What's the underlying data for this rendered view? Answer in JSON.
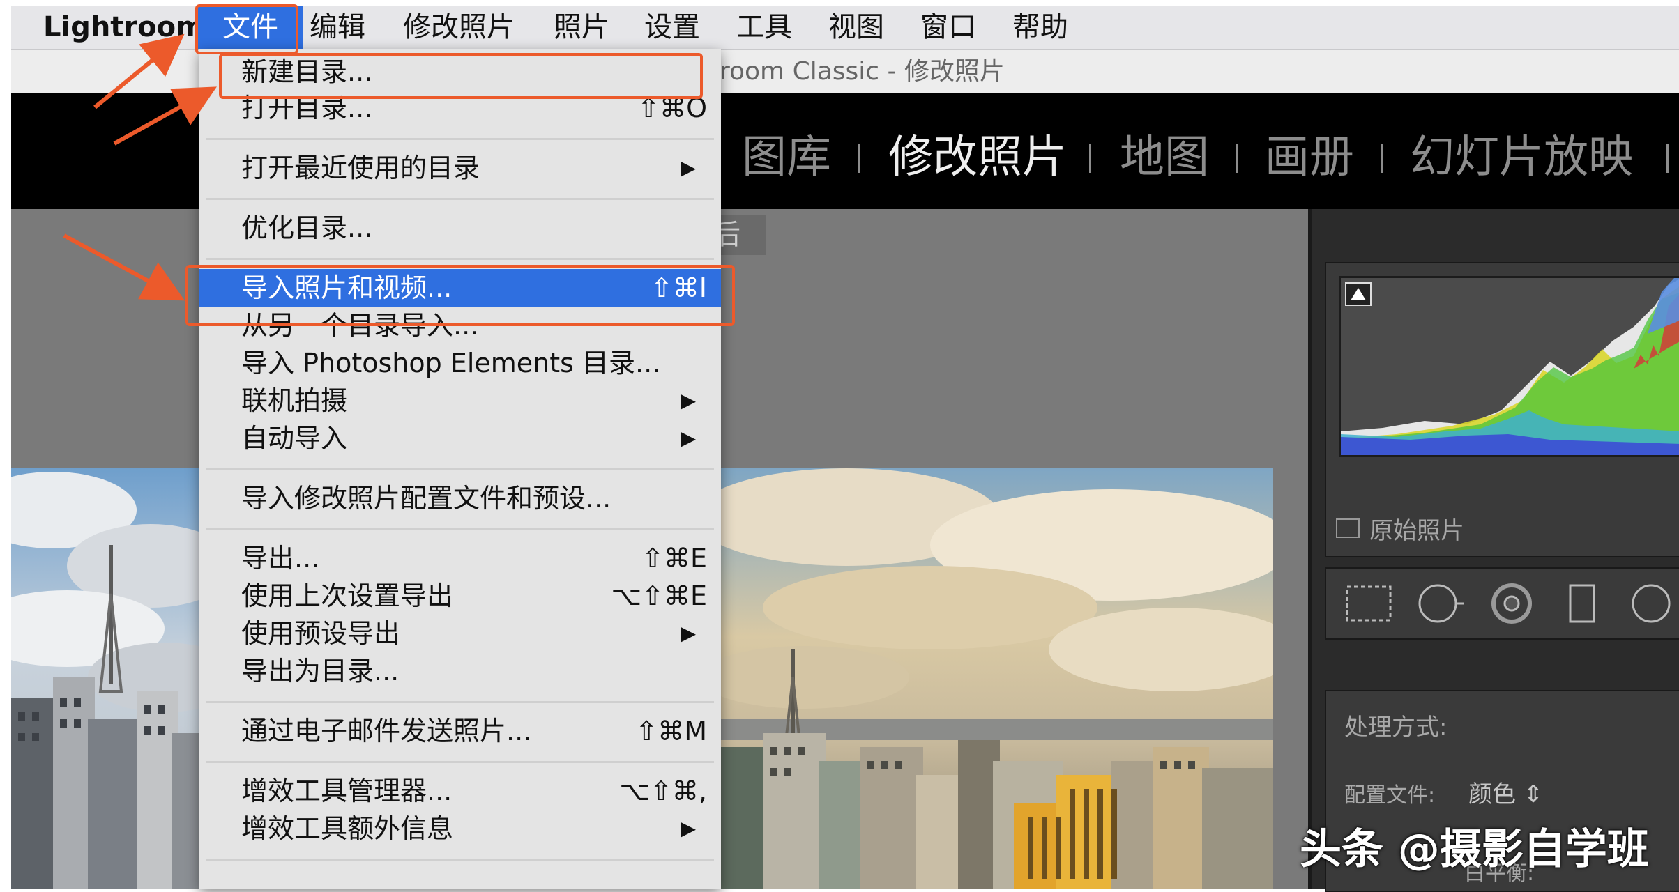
{
  "menubar": {
    "app": "Lightroom",
    "items": [
      "文件",
      "编辑",
      "修改照片",
      "照片",
      "设置",
      "工具",
      "视图",
      "窗口",
      "帮助"
    ]
  },
  "window_title": "room Classic - 修改照片",
  "modules": [
    "图库",
    "修改照片",
    "地图",
    "画册",
    "幻灯片放映"
  ],
  "active_module": "修改照片",
  "before_after_label": "后",
  "file_menu": {
    "items": [
      {
        "label": "新建目录...",
        "shortcut": ""
      },
      {
        "label": "打开目录...",
        "shortcut": "⇧⌘O"
      },
      {
        "label": "打开最近使用的目录",
        "submenu": "▶"
      },
      {
        "label": "优化目录...",
        "shortcut": ""
      },
      {
        "label": "导入照片和视频...",
        "shortcut": "⇧⌘I"
      },
      {
        "label": "从另一个目录导入...",
        "shortcut": ""
      },
      {
        "label": "导入 Photoshop Elements 目录...",
        "shortcut": ""
      },
      {
        "label": "联机拍摄",
        "submenu": "▶"
      },
      {
        "label": "自动导入",
        "submenu": "▶"
      },
      {
        "label": "导入修改照片配置文件和预设...",
        "shortcut": ""
      },
      {
        "label": "导出...",
        "shortcut": "⇧⌘E"
      },
      {
        "label": "使用上次设置导出",
        "shortcut": "⌥⇧⌘E"
      },
      {
        "label": "使用预设导出",
        "submenu": "▶"
      },
      {
        "label": "导出为目录...",
        "shortcut": ""
      },
      {
        "label": "通过电子邮件发送照片...",
        "shortcut": "⇧⌘M"
      },
      {
        "label": "增效工具管理器...",
        "shortcut": "⌥⇧⌘,"
      },
      {
        "label": "增效工具额外信息",
        "submenu": "▶"
      }
    ]
  },
  "right_panel": {
    "original_photo": "原始照片",
    "treatment": "处理方式:",
    "profile_label": "配置文件:",
    "profile_value": "颜色 ⇕",
    "white_balance": "白平衡:"
  },
  "watermark": "头条 @摄影自学班",
  "colors": {
    "accent": "#2f6fe0",
    "highlight_box": "#ec5a2b",
    "menu_bg": "#e4e4e4"
  }
}
